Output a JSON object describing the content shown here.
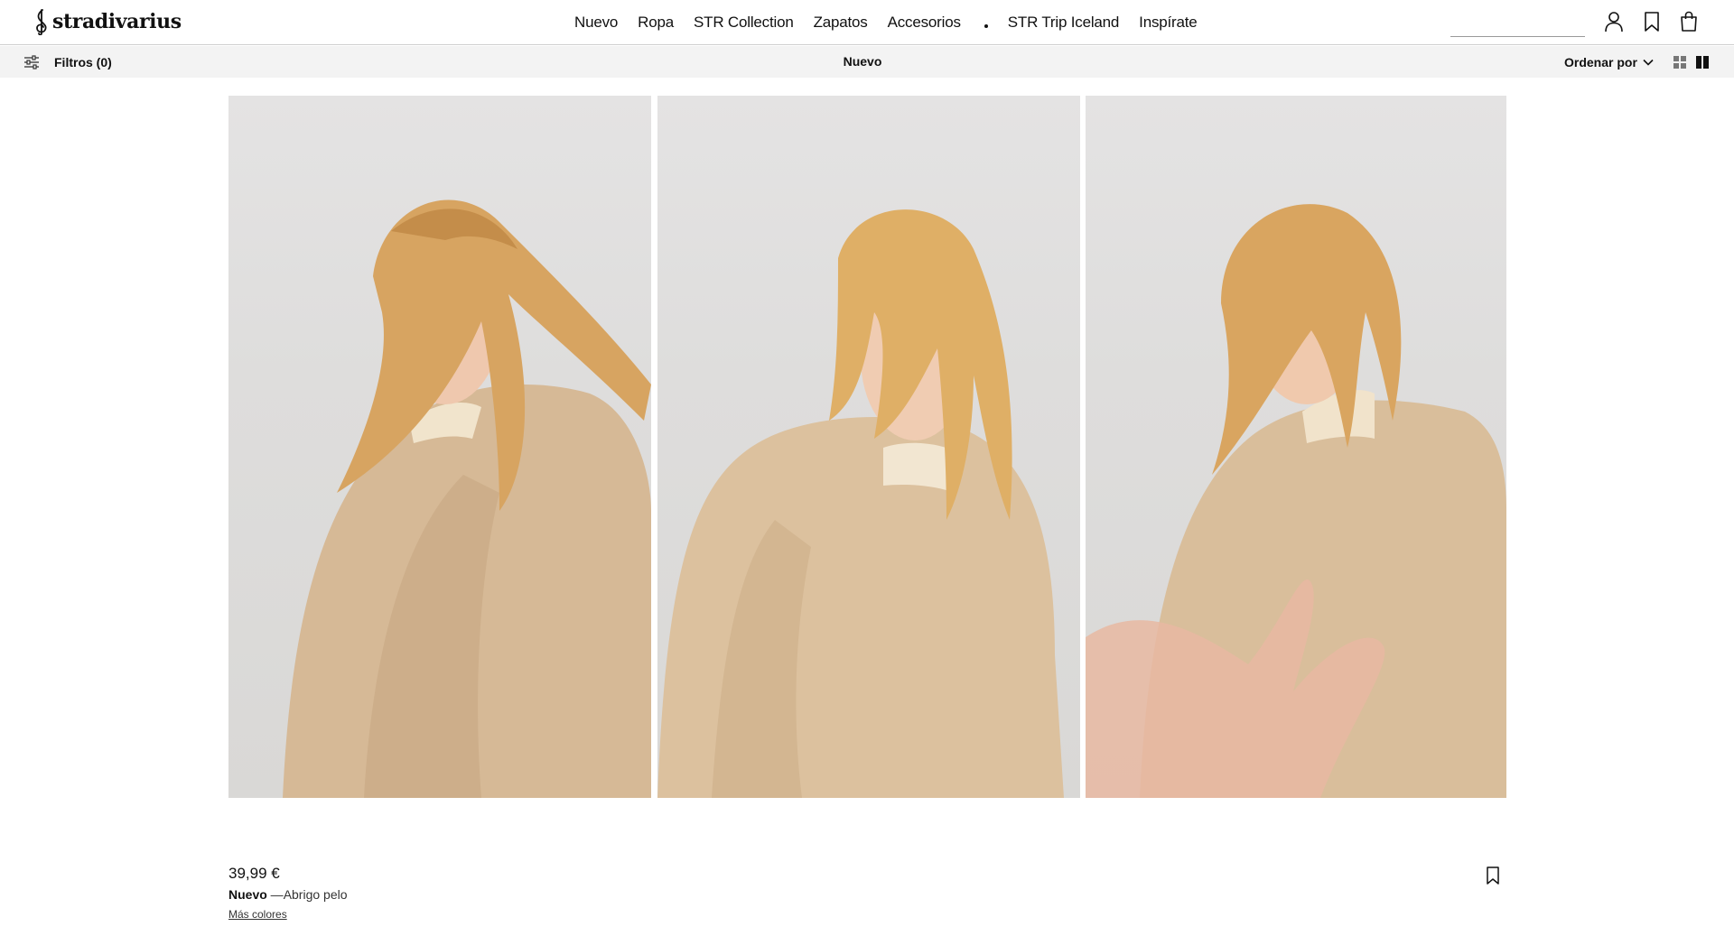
{
  "header": {
    "logo_text": "stradivarius",
    "nav": [
      "Nuevo",
      "Ropa",
      "STR Collection",
      "Zapatos",
      "Accesorios",
      "STR Trip Iceland",
      "Inspírate"
    ],
    "search": {
      "value": "",
      "placeholder": ""
    }
  },
  "subbar": {
    "filters_label": "Filtros (0)",
    "title": "Nuevo",
    "sort_label": "Ordenar por"
  },
  "product": {
    "price": "39,99 €",
    "badge": "Nuevo",
    "separator": " —",
    "name": "Abrigo pelo",
    "more_colors": "Más colores"
  },
  "icons": {
    "search": "search-icon",
    "user": "user-icon",
    "wishlist": "bookmark-icon",
    "bag": "shopping-bag-icon",
    "filters": "sliders-icon",
    "sort": "chevron-down-icon",
    "grid_small": "grid-four-icon",
    "grid_large": "grid-two-icon"
  },
  "colors": {
    "background": "#ffffff",
    "subbar": "#f3f3f3",
    "text": "#111111",
    "photo_bg": "#dedddc",
    "coat": "#d8bc98",
    "hair": "#d9a863"
  }
}
